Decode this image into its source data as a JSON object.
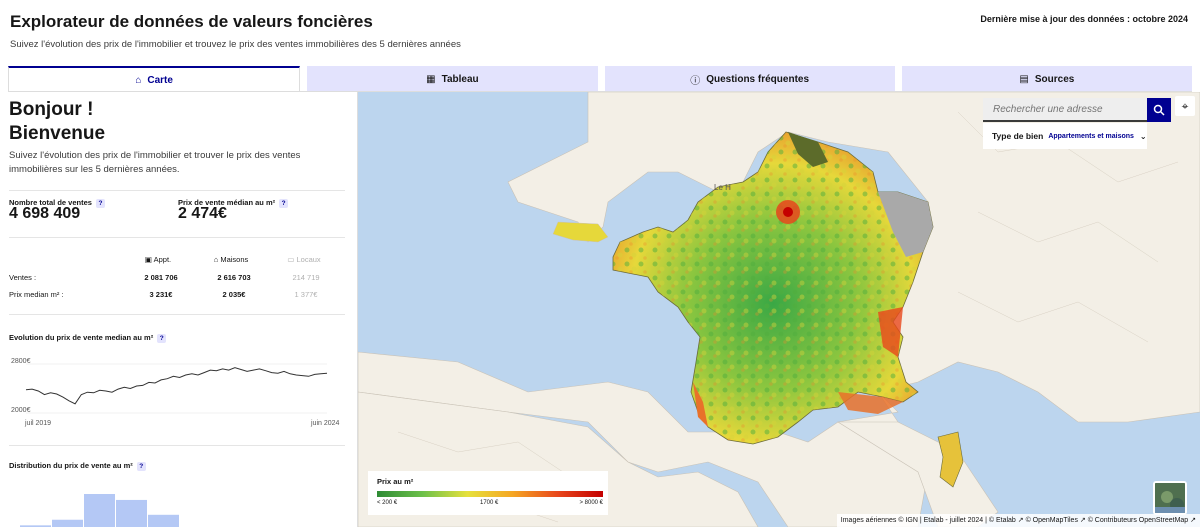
{
  "header": {
    "title": "Explorateur de données de valeurs foncières",
    "subtitle": "Suivez l'évolution des prix de l'immobilier et trouvez le prix des ventes immobilières des 5 dernières années",
    "updated": "Dernière mise à jour des données : octobre 2024"
  },
  "tabs": [
    {
      "label": "Carte",
      "icon": "home-icon"
    },
    {
      "label": "Tableau",
      "icon": "table-icon"
    },
    {
      "label": "Questions fréquentes",
      "icon": "info-icon"
    },
    {
      "label": "Sources",
      "icon": "document-icon"
    }
  ],
  "panel": {
    "greeting1": "Bonjour !",
    "greeting2": "Bienvenue",
    "intro": "Suivez l'évolution des prix de l'immobilier et trouver le prix des ventes immobilières sur les 5 dernières années.",
    "total_sales_label": "Nombre total de ventes",
    "total_sales_value": "4 698 409",
    "median_price_label": "Prix de vente médian au m²",
    "median_price_value": "2 474€",
    "table": {
      "headers": [
        "Appt.",
        "Maisons",
        "Locaux"
      ],
      "rows": [
        {
          "label": "Ventes :",
          "values": [
            "2 081 706",
            "2 616 703",
            "214 719"
          ]
        },
        {
          "label": "Prix median m² :",
          "values": [
            "3 231€",
            "2 035€",
            "1 377€"
          ]
        }
      ]
    },
    "evolution_title": "Evolution du prix de vente median au m²",
    "evolution_y_top": "2800€",
    "evolution_y_bottom": "2000€",
    "evolution_x_start": "juil 2019",
    "evolution_x_end": "juin 2024",
    "distribution_title": "Distribution du prix de vente au m²",
    "qmark": "?"
  },
  "chart_data": [
    {
      "type": "line",
      "title": "Evolution du prix de vente median au m²",
      "x_start": "juil 2019",
      "x_end": "juin 2024",
      "ylim": [
        2000,
        2800
      ],
      "yticks": [
        "2800€",
        "2000€"
      ],
      "values": [
        2380,
        2390,
        2360,
        2300,
        2330,
        2310,
        2260,
        2200,
        2150,
        2300,
        2340,
        2330,
        2370,
        2360,
        2340,
        2390,
        2420,
        2400,
        2440,
        2450,
        2500,
        2490,
        2540,
        2560,
        2600,
        2580,
        2620,
        2640,
        2620,
        2660,
        2700,
        2690,
        2720,
        2700,
        2740,
        2710,
        2680,
        2700,
        2720,
        2690,
        2660,
        2650,
        2680,
        2640,
        2620,
        2610,
        2600,
        2630,
        2640,
        2650
      ]
    },
    {
      "type": "bar",
      "title": "Distribution du prix de vente au m²",
      "values": [
        0.05,
        0.22,
        1.0,
        0.82,
        0.37
      ]
    }
  ],
  "map": {
    "search_placeholder": "Rechercher une adresse",
    "type_bien_label": "Type de bien",
    "type_bien_value": "Appartements et maisons",
    "legend_title": "Prix au m²",
    "legend_min": "< 200 €",
    "legend_mid": "1700 €",
    "legend_max": "> 8000 €",
    "attribution": "Images aériennes © IGN | Etalab - juillet 2024 | © Etalab ↗ © OpenMapTiles ↗ © Contributeurs OpenStreetMap ↗",
    "place_label": "Le H",
    "colors": {
      "sea": "#bcd5ee",
      "land": "#f3efe6",
      "accent": "#000091"
    }
  }
}
